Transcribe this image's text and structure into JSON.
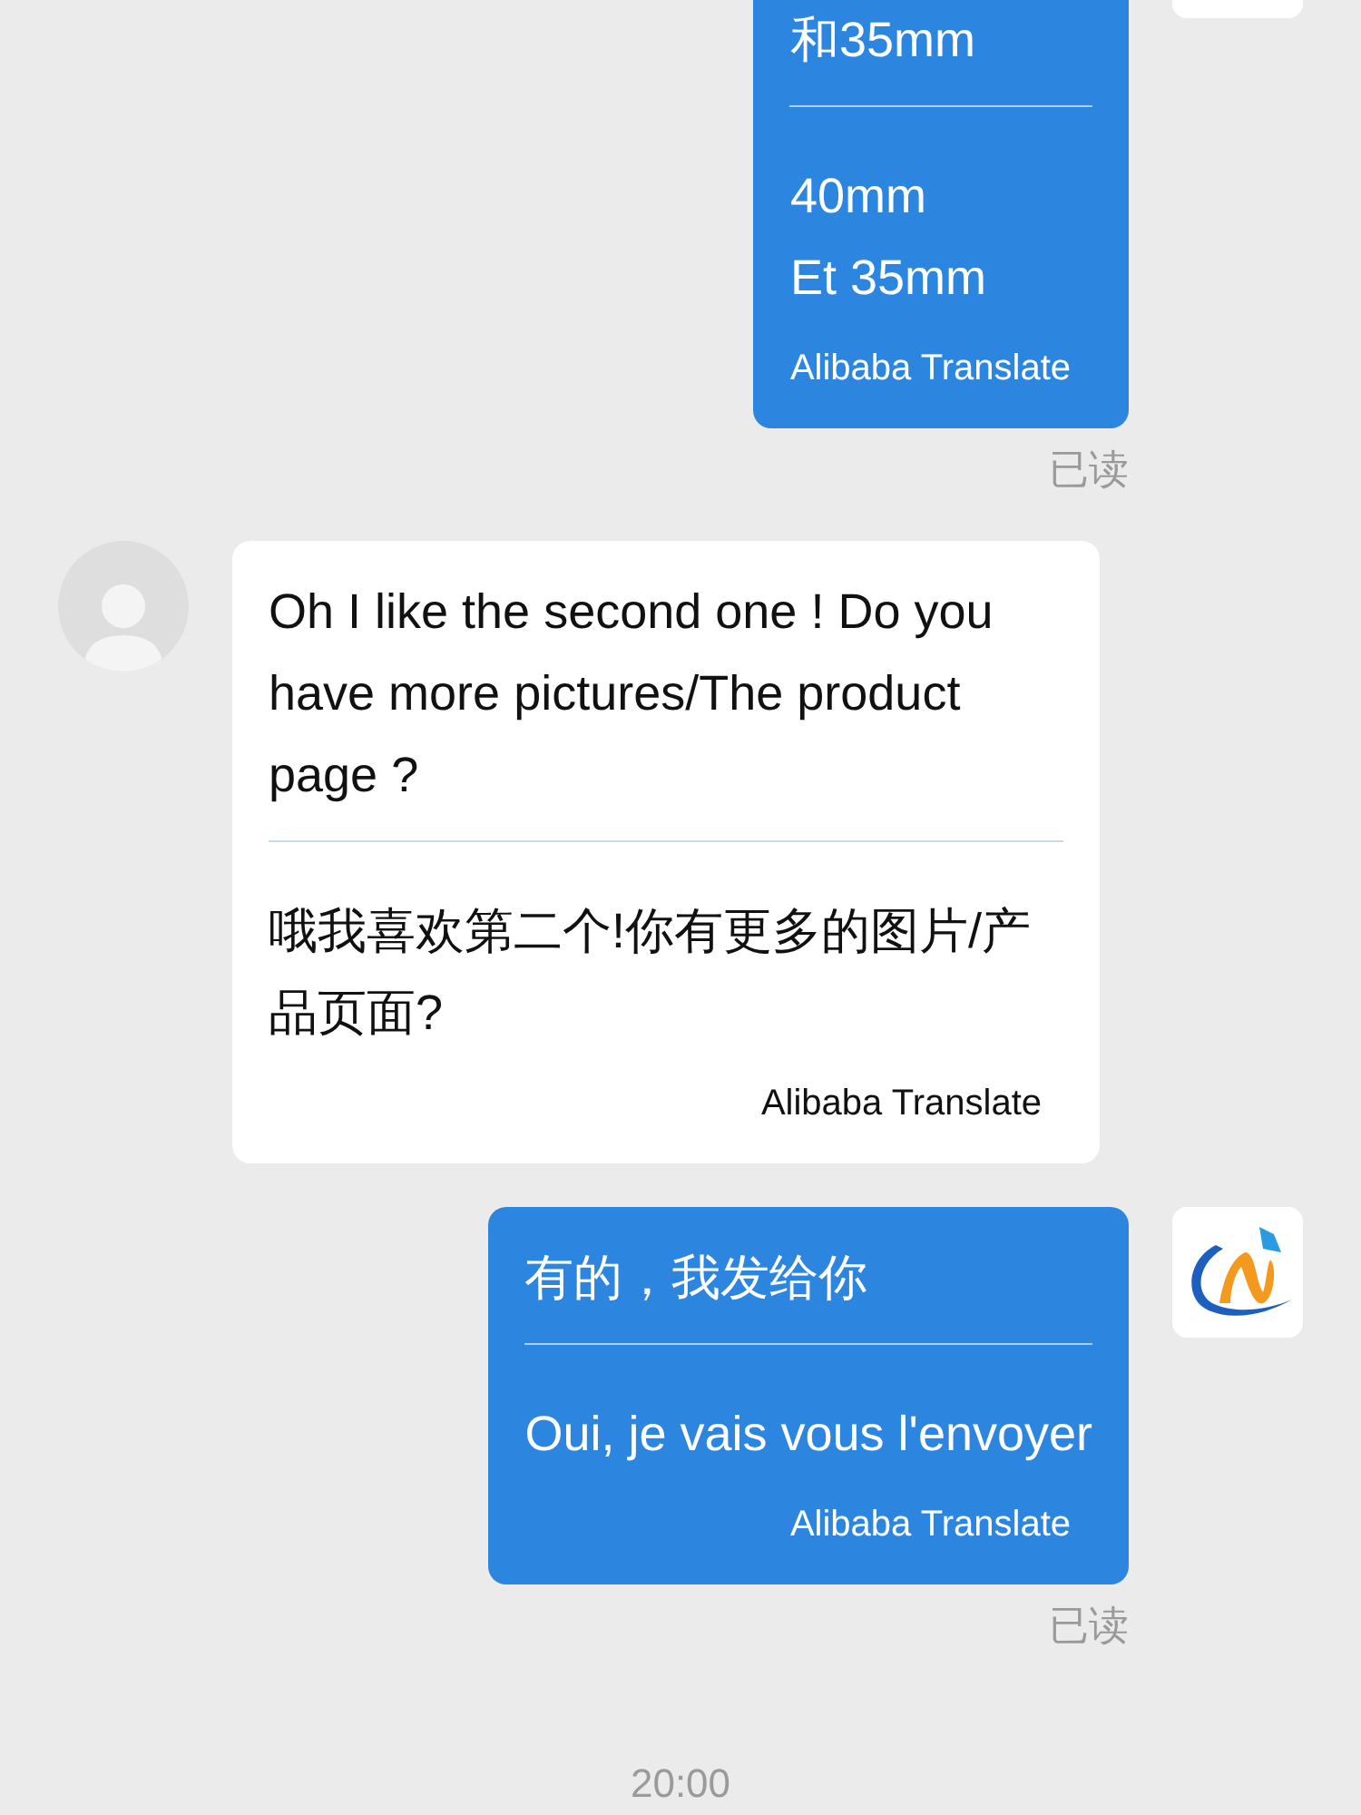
{
  "messages": [
    {
      "kind": "outgoing",
      "original": [
        "和35mm"
      ],
      "translation": [
        "40mm",
        "Et 35mm"
      ],
      "attribution": "Alibaba Translate",
      "status": "已读"
    },
    {
      "kind": "incoming",
      "original": [
        "Oh I like the second one ! Do you have more pictures/The product page ?"
      ],
      "translation": [
        "哦我喜欢第二个!你有更多的图片/产品页面?"
      ],
      "attribution": "Alibaba Translate"
    },
    {
      "kind": "outgoing",
      "original": [
        "有的，我发给你"
      ],
      "translation": [
        "Oui, je vais vous l'envoyer"
      ],
      "attribution": "Alibaba Translate",
      "status": "已读"
    }
  ],
  "timestamp": "20:00"
}
